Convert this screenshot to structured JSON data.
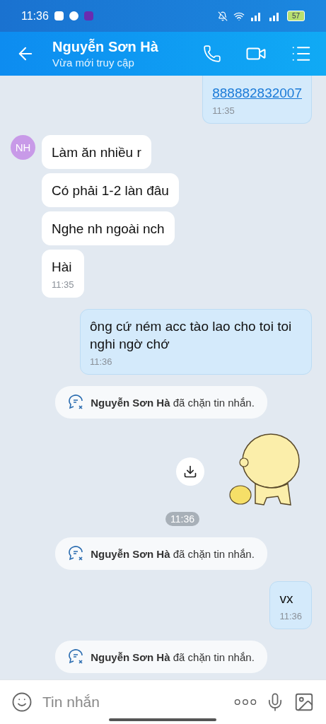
{
  "status_bar": {
    "time": "11:36",
    "battery": "57"
  },
  "header": {
    "name": "Nguyễn Sơn Hà",
    "status": "Vừa mới truy cập"
  },
  "messages": [
    {
      "kind": "sent",
      "link": "888882832007",
      "time": "11:35"
    },
    {
      "kind": "received",
      "avatar": "NH",
      "text": "Làm ăn nhiều r"
    },
    {
      "kind": "received",
      "text": "Có phải 1-2 làn đâu"
    },
    {
      "kind": "received",
      "text": "Nghe nh ngoài nch"
    },
    {
      "kind": "received",
      "text": "Hài",
      "time": "11:35"
    },
    {
      "kind": "sent",
      "text": "ông cứ ném acc tào lao cho toi toi nghi ngờ chớ",
      "time": "11:36"
    },
    {
      "kind": "notice",
      "text": "**Nguyễn Sơn Hà** đã chặn tin nhắn."
    },
    {
      "kind": "sticker",
      "time": "11:36"
    },
    {
      "kind": "notice",
      "text": "**Nguyễn Sơn Hà** đã chặn tin nhắn."
    },
    {
      "kind": "sent",
      "text": "vx",
      "time": "11:36"
    },
    {
      "kind": "notice",
      "text": "**Nguyễn Sơn Hà** đã chặn tin nhắn."
    }
  ],
  "composer": {
    "placeholder": "Tin nhắn"
  }
}
